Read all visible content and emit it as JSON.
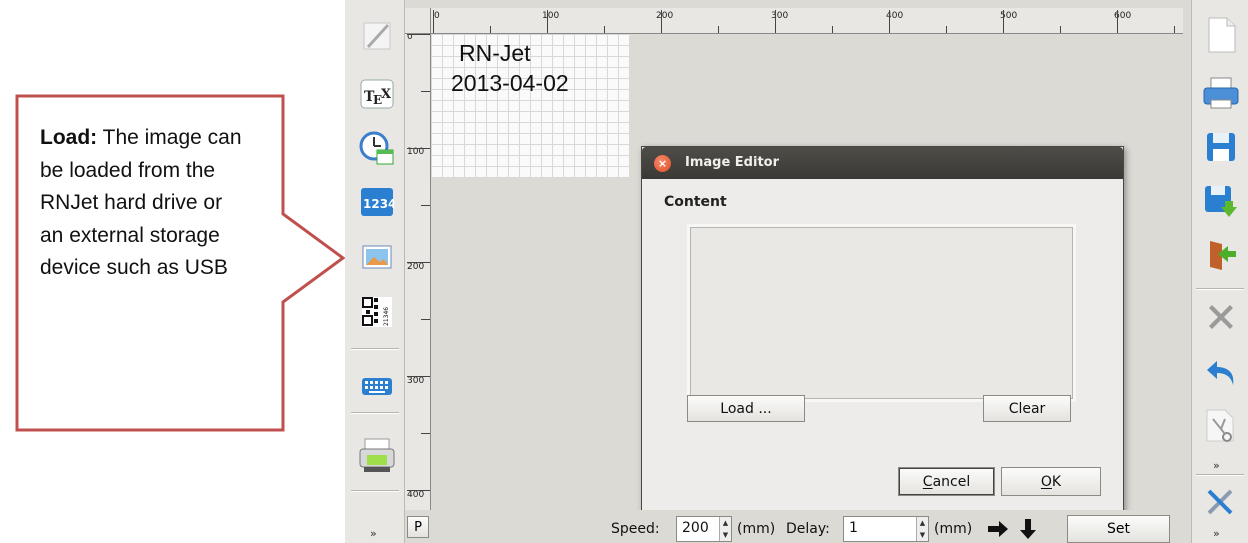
{
  "callout": {
    "label_bold": "Load:",
    "text": "The image can be loaded from the RNJet hard drive or an external storage device such as USB",
    "border_color": "#c0504d"
  },
  "ruler": {
    "top_labels": [
      "0",
      "100",
      "200",
      "300",
      "400",
      "500",
      "600"
    ],
    "left_labels": [
      "0",
      "100",
      "200",
      "300",
      "400"
    ]
  },
  "canvas": {
    "line1": "RN-Jet",
    "line2": "2013-04-02"
  },
  "left_toolbar": [
    {
      "name": "text-tool",
      "icon": "pencil-icon"
    },
    {
      "name": "tex-tool",
      "icon": "tex-icon",
      "label": "TEX"
    },
    {
      "name": "datetime-tool",
      "icon": "clock-calendar-icon"
    },
    {
      "name": "counter-tool",
      "icon": "counter-icon",
      "label": "1234"
    },
    {
      "name": "image-tool",
      "icon": "image-icon"
    },
    {
      "name": "barcode-tool",
      "icon": "qr-code-icon",
      "label": "21346"
    },
    {
      "name": "keyboard-tool",
      "icon": "keyboard-icon"
    },
    {
      "name": "print-tool",
      "icon": "printer-icon"
    }
  ],
  "right_toolbar": [
    {
      "name": "new-button",
      "icon": "new-file-icon"
    },
    {
      "name": "print-button",
      "icon": "printer-icon"
    },
    {
      "name": "save-button",
      "icon": "floppy-icon"
    },
    {
      "name": "save-as-button",
      "icon": "floppy-arrow-icon"
    },
    {
      "name": "exit-button",
      "icon": "door-exit-icon"
    },
    {
      "name": "delete-button",
      "icon": "x-icon"
    },
    {
      "name": "undo-button",
      "icon": "undo-icon"
    },
    {
      "name": "cut-button",
      "icon": "scissors-icon"
    },
    {
      "name": "settings-button",
      "icon": "tools-icon"
    }
  ],
  "dialog": {
    "title": "Image Editor",
    "content_label": "Content",
    "load_label": "Load ...",
    "clear_label": "Clear",
    "cancel_first": "C",
    "cancel_rest": "ancel",
    "ok_first": "O",
    "ok_rest": "K",
    "titlebar_color": "#3c3b37",
    "close_color": "#df4b24"
  },
  "bottom_bar": {
    "p_label": "P",
    "speed_label": "Speed:",
    "speed_value": "200",
    "speed_unit": "(mm)",
    "delay_label": "Delay:",
    "delay_value": "1",
    "delay_unit": "(mm)",
    "set_label": "Set"
  },
  "more_glyph": "»"
}
